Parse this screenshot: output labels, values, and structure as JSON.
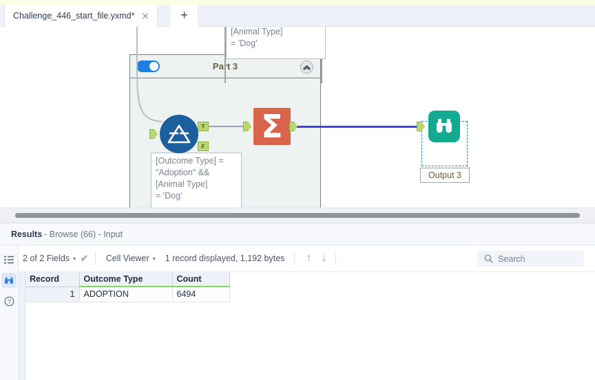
{
  "window": {
    "tab": {
      "title": "Challenge_446_start_file.yxmd*",
      "close_icon": "close-icon",
      "new_tab_icon": "plus-icon"
    }
  },
  "canvas": {
    "container": {
      "title": "Part 3",
      "toggle_on": true,
      "collapse_icon": "chevron-up-icon"
    },
    "annotations": [
      {
        "id": "top",
        "text": "[Animal Type]\n= 'Dog'"
      },
      {
        "id": "main",
        "text": "[Outcome Type] =\n\"Adoption\" &&\n[Animal Type]\n= 'Dog'"
      }
    ],
    "tools": [
      {
        "id": "filter",
        "icon": "filter-tool-icon",
        "color": "#1b5f9e",
        "outputs": [
          "T",
          "F"
        ]
      },
      {
        "id": "summarize",
        "icon": "summarize-tool-icon",
        "color": "#d9644a",
        "glyph": "Σ"
      },
      {
        "id": "browse",
        "icon": "browse-binoculars-icon",
        "color": "#12ab91",
        "label": "Output 3",
        "selected": true
      }
    ],
    "connections": [
      {
        "from": "filter.T",
        "to": "summarize.in",
        "color": "#9aa3ab",
        "selected": false
      },
      {
        "from": "summarize.out",
        "to": "browse.in",
        "color": "#4040ee",
        "selected": true
      }
    ]
  },
  "results": {
    "header": {
      "label": "Results",
      "detail": "- Browse (66) - Input"
    },
    "rail": [
      {
        "icon": "list-view-icon",
        "active": false
      },
      {
        "icon": "browse-binoculars-icon",
        "active": true
      },
      {
        "icon": "help-circle-icon",
        "active": false
      }
    ],
    "toolbar": {
      "fields": "2 of 2 Fields",
      "fields_caret": "▾",
      "check_icon": "checkmark-icon",
      "viewer": "Cell Viewer",
      "viewer_caret": "▾",
      "record_info": "1 record displayed, 1,192 bytes",
      "up_icon": "arrow-up-icon",
      "down_icon": "arrow-down-icon"
    },
    "search": {
      "placeholder": "Search",
      "icon": "search-icon",
      "value": ""
    },
    "table": {
      "columns": [
        "Record",
        "Outcome Type",
        "Count"
      ],
      "rows": [
        {
          "record": "1",
          "outcome_type": "ADOPTION",
          "count": "6494"
        }
      ]
    }
  }
}
